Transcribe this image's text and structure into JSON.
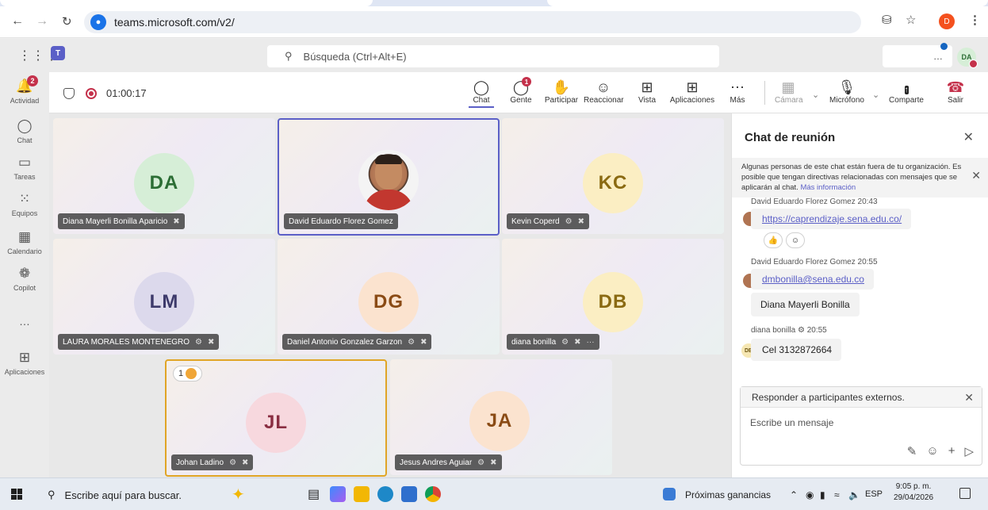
{
  "browser": {
    "url": "teams.microsoft.com/v2/",
    "profile_initial": "D"
  },
  "header": {
    "search_placeholder": "Búsqueda (Ctrl+Alt+E)",
    "more_label": "…",
    "user_initials": "DA"
  },
  "rail": {
    "items": [
      {
        "label": "Actividad",
        "icon": "bell-icon",
        "badge": "2"
      },
      {
        "label": "Chat",
        "icon": "chat-icon"
      },
      {
        "label": "Tareas",
        "icon": "tasks-icon"
      },
      {
        "label": "Equipos",
        "icon": "teams-icon"
      },
      {
        "label": "Calendario",
        "icon": "calendar-icon"
      },
      {
        "label": "Copilot",
        "icon": "copilot-icon"
      },
      {
        "label": "…",
        "icon": "more-icon"
      },
      {
        "label": "Aplicaciones",
        "icon": "plus-icon"
      }
    ]
  },
  "meeting": {
    "timer": "01:00:17",
    "toolbar": {
      "chat": "Chat",
      "people": "Gente",
      "people_badge": "1",
      "raise": "Participar",
      "react": "Reaccionar",
      "view": "Vista",
      "apps": "Aplicaciones",
      "more": "Más",
      "camera": "Cámara",
      "mic": "Micrófono",
      "share": "Comparte",
      "leave": "Salir"
    },
    "participants": [
      {
        "initials": "DA",
        "name": "Diana Mayerli Bonilla Aparicio",
        "color": "#d6eed7",
        "text_color": "#2c6e35"
      },
      {
        "initials": "",
        "name": "David Eduardo Florez Gomez",
        "photo": true
      },
      {
        "initials": "KC",
        "name": "Kevin Coperd",
        "color": "#fbeec3",
        "text_color": "#8a6a12"
      },
      {
        "initials": "LM",
        "name": "LAURA MORALES MONTENEGRO",
        "color": "#dcd9ec",
        "text_color": "#3d3a6b"
      },
      {
        "initials": "DG",
        "name": "Daniel Antonio Gonzalez Garzon",
        "color": "#fbe3cf",
        "text_color": "#8a4b15"
      },
      {
        "initials": "DB",
        "name": "diana bonilla",
        "color": "#fbeec3",
        "text_color": "#8a6a12",
        "extra": "···"
      },
      {
        "initials": "JL",
        "name": "Johan Ladino",
        "color": "#f7d8de",
        "text_color": "#8a2e42",
        "hand": "1"
      },
      {
        "initials": "JA",
        "name": "Jesus Andres Aguiar",
        "color": "#fbe3cf",
        "text_color": "#8a4b15"
      }
    ]
  },
  "chat": {
    "title": "Chat de reunión",
    "notice": "Algunas personas de este chat están fuera de tu organización. Es posible que tengan directivas relacionadas con mensajes que se aplicarán al chat.",
    "notice_link": "Más información",
    "messages": [
      {
        "meta": "David Eduardo Florez Gomez  20:43",
        "link": "https://caprendizaje.sena.edu.co/"
      },
      {
        "meta": "David Eduardo Florez Gomez  20:55",
        "link": "dmbonilla@sena.edu.co"
      },
      {
        "text": "Diana Mayerli Bonilla"
      },
      {
        "meta": "diana bonilla",
        "time": "20:55",
        "text": "Cel 3132872664",
        "initials": "DB"
      }
    ],
    "reply_bar": "Responder a participantes externos.",
    "compose_placeholder": "Escribe un mensaje"
  },
  "taskbar": {
    "search": "Escribe aquí para buscar.",
    "news": "Próximas ganancias",
    "lang": "ESP",
    "time": "9:05 p. m.",
    "date": "29/04/2026"
  }
}
